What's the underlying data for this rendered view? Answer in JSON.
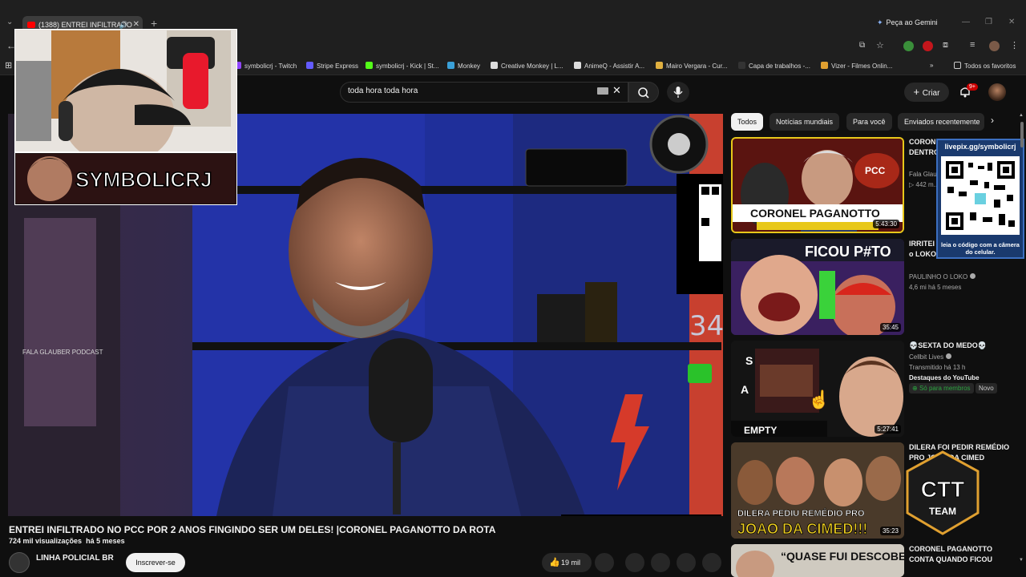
{
  "browser": {
    "tab_title": "(1388) ENTREI INFILTRADO",
    "gemini_label": "Peça ao Gemini",
    "bookmarks": [
      {
        "label": "symbolicrj - Twitch",
        "color": "#9146ff"
      },
      {
        "label": "Stripe Express",
        "color": "#635bff"
      },
      {
        "label": "symbolicrj - Kick | St...",
        "color": "#53fc18"
      },
      {
        "label": "Monkey",
        "color": "#3aa0d8"
      },
      {
        "label": "Creative Monkey | L...",
        "color": "#dddddd"
      },
      {
        "label": "AnimeQ - Assistir A...",
        "color": "#dddddd"
      },
      {
        "label": "Mairo Vergara - Cur...",
        "color": "#e0b040"
      },
      {
        "label": "Capa de trabalhos -...",
        "color": "#333333"
      },
      {
        "label": "Vizer - Filmes Onlin...",
        "color": "#e0a030"
      }
    ],
    "all_favorites": "Todos os favoritos"
  },
  "masthead": {
    "search_value": "toda hora toda hora",
    "create_label": "Criar",
    "notification_count": "9+"
  },
  "stream_overlay": {
    "streamer_name": "SYMBOLICRJ"
  },
  "video": {
    "title": "ENTREI INFILTRADO NO PCC POR 2 ANOS FINGINDO SER UM DELES! |CORONEL PAGANOTTO DA ROTA",
    "views": "724 mil visualizações",
    "age": "há 5 meses",
    "channel": "LINHA POLICIAL BR",
    "subscribe_label": "Inscrever-se",
    "likes": "19 mil",
    "video_scene_text": "FALA GLAUBER PODCAST"
  },
  "chips": [
    "Todos",
    "Notícias mundiais",
    "Para você",
    "Enviados recentemente"
  ],
  "related": [
    {
      "title": "CORONEL PAGANOTTO: POR DENTRO DO PCC: A F4CÇÃO",
      "channel": "Fala Glau...",
      "stats": "▷ 442 m...",
      "duration": "5:43:30",
      "thumb_text": "CORONEL PAGANOTTO",
      "thumb_tag": "PCC"
    },
    {
      "title": "IRRITEI ... ao VIVO (Paulinho o LOKO)",
      "channel": "PAULINHO O LOKO",
      "stats": "4,6 mi  há 5 meses",
      "duration": "35:45",
      "thumb_text": "FICOU P#TO"
    },
    {
      "title": "💀SEXTA DO MEDO💀",
      "channel": "Cellbit Lives",
      "stats": "Transmitido há 13 h",
      "extra": "Destaques do YouTube",
      "members": "Só para membros",
      "new": "Novo",
      "duration": "5:27:41",
      "thumb_text": "EMPTY"
    },
    {
      "title": "DILERA FOI PEDIR REMÉDIO PRO JOÃO DA CIMED",
      "duration": "35:23",
      "thumb_text": "DILERA PEDIU REMÉDIO PRO JOAO DA CIMED!!!"
    },
    {
      "title": "CORONEL PAGANOTTO CONTA QUANDO FICOU",
      "thumb_text": "“QUASE FUI DESCOBERTO"
    }
  ],
  "qr_overlay": {
    "url": "livepix.gg/symbolicrj",
    "caption": "leia o código com a câmera do celular."
  },
  "ctt_logo": {
    "line1": "CTT",
    "line2": "TEAM"
  },
  "colors": {
    "yt_red": "#ff0000",
    "bg": "#0f0f0f",
    "members_green": "#2ba640"
  }
}
